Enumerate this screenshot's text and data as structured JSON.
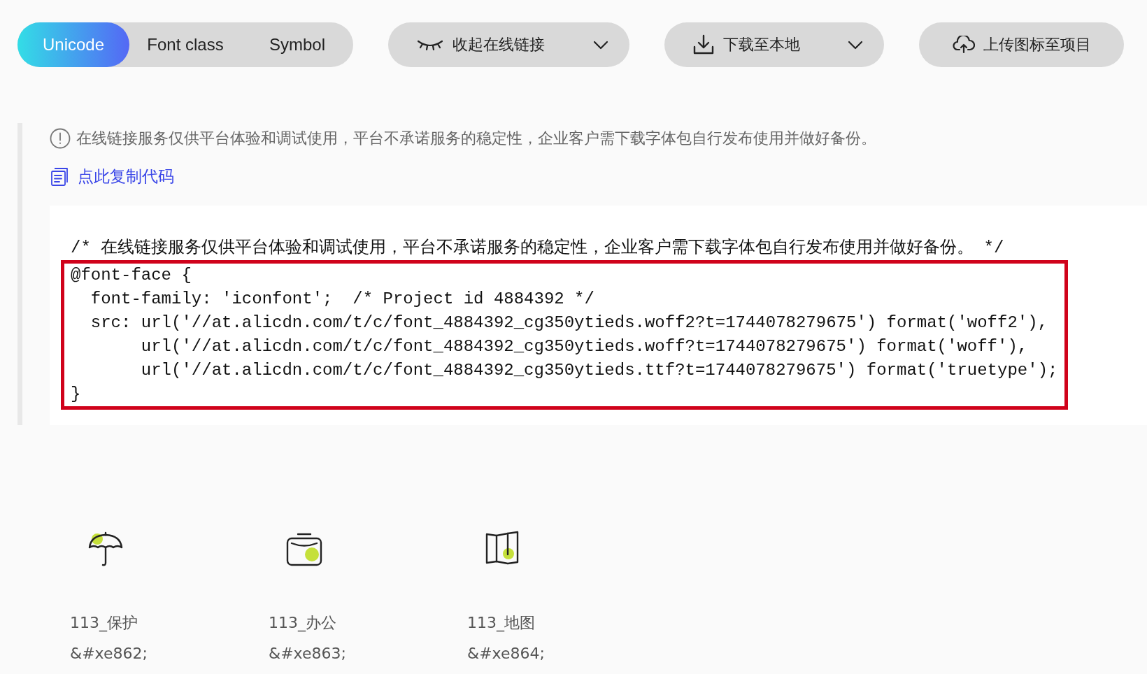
{
  "tabs": [
    {
      "label": "Unicode",
      "selected": true
    },
    {
      "label": "Font class",
      "selected": false
    },
    {
      "label": "Symbol",
      "selected": false
    }
  ],
  "buttons": [
    {
      "label": "收起在线链接",
      "dropdown": true
    },
    {
      "label": "下载至本地",
      "dropdown": true
    },
    {
      "label": "上传图标至项目",
      "dropdown": false
    }
  ],
  "notice": "在线链接服务仅供平台体验和调试使用，平台不承诺服务的稳定性，企业客户需下载字体包自行发布使用并做好备份。",
  "copy_link": "点此复制代码",
  "code": [
    {
      "text": "/* 在线链接服务仅供平台体验和调试使用，平台不承诺服务的稳定性，企业客户需下载字体包自行发布使用并做好备份。 */",
      "highlighted": false
    },
    {
      "text": "@font-face {",
      "highlighted": true
    },
    {
      "text": "  font-family: 'iconfont';  /* Project id 4884392 */",
      "highlighted": true
    },
    {
      "text": "  src: url('//at.alicdn.com/t/c/font_4884392_cg350ytieds.woff2?t=1744078279675') format('woff2'),",
      "highlighted": true
    },
    {
      "text": "       url('//at.alicdn.com/t/c/font_4884392_cg350ytieds.woff?t=1744078279675') format('woff'),",
      "highlighted": true
    },
    {
      "text": "       url('//at.alicdn.com/t/c/font_4884392_cg350ytieds.ttf?t=1744078279675') format('truetype');",
      "highlighted": true
    },
    {
      "text": "}",
      "highlighted": true
    }
  ],
  "icons": [
    {
      "name": "113_保护",
      "code": "&#xe862;"
    },
    {
      "name": "113_办公",
      "code": "&#xe863;"
    },
    {
      "name": "113_地图",
      "code": "&#xe864;"
    }
  ]
}
